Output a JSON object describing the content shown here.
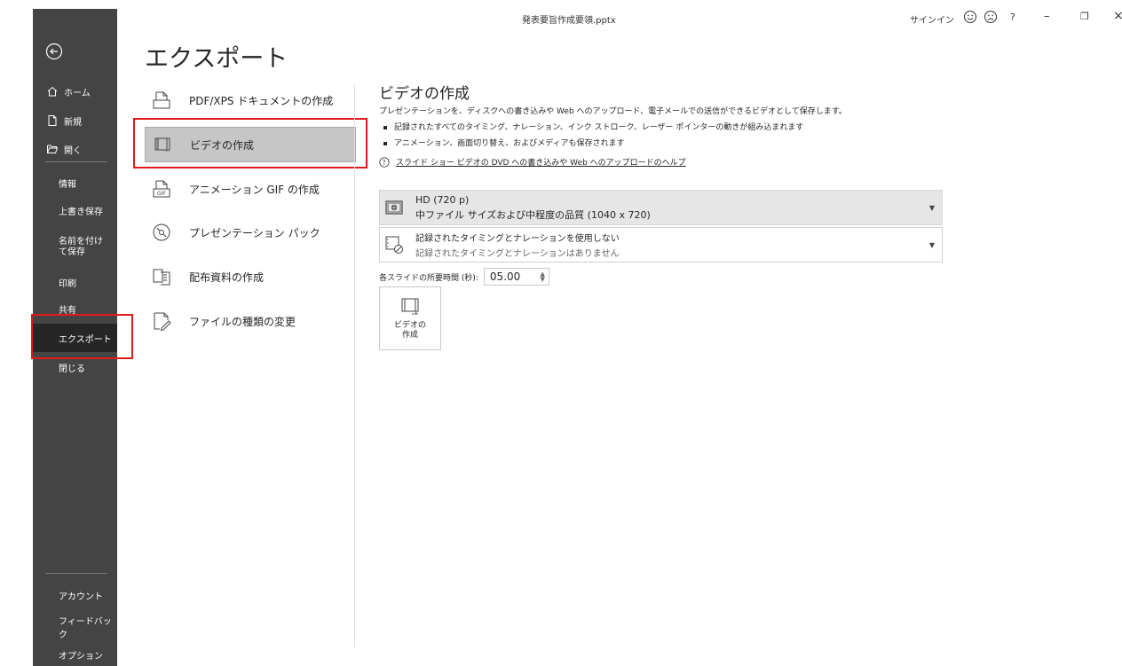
{
  "window": {
    "doc_title": "発表要旨作成要領.pptx",
    "signin": "サインイン",
    "help": "?",
    "minimize": "–",
    "restore": "❐",
    "close": "×"
  },
  "sidebar": {
    "home": "ホーム",
    "new": "新規",
    "open": "開く",
    "info": "情報",
    "save": "上書き保存",
    "save_as": "名前を付けて保存",
    "print": "印刷",
    "share": "共有",
    "export": "エクスポート",
    "close": "閉じる",
    "account": "アカウント",
    "feedback": "フィードバック",
    "options": "オプション"
  },
  "page_title": "エクスポート",
  "export_options": [
    {
      "label": "PDF/XPS ドキュメントの作成",
      "icon": "pdf-document-icon"
    },
    {
      "label": "ビデオの作成",
      "icon": "video-icon",
      "selected": true
    },
    {
      "label": "アニメーション GIF の作成",
      "icon": "gif-icon"
    },
    {
      "label": "プレゼンテーション パック",
      "icon": "package-cd-icon"
    },
    {
      "label": "配布資料の作成",
      "icon": "handouts-icon"
    },
    {
      "label": "ファイルの種類の変更",
      "icon": "change-file-type-icon"
    }
  ],
  "detail": {
    "title": "ビデオの作成",
    "description": "プレゼンテーションを、ディスクへの書き込みや Web へのアップロード、電子メールでの送信ができるビデオとして保存します。",
    "bullets": [
      "記録されたすべてのタイミング、ナレーション、インク ストローク、レーザー ポインターの動きが組み込まれます",
      "アニメーション、画面切り替え、およびメディアも保存されます"
    ],
    "help_link": "スライド ショー ビデオの DVD への書き込みや Web へのアップロードのヘルプ",
    "quality": {
      "title": "HD (720 p)",
      "subtitle": "中ファイル サイズおよび中程度の品質 (1040 x 720)"
    },
    "timing": {
      "title": "記録されたタイミングとナレーションを使用しない",
      "subtitle": "記録されたタイミングとナレーションはありません"
    },
    "duration_label": "各スライドの所要時間 (秒):",
    "duration_value": "05.00",
    "create_button": "ビデオの作成"
  },
  "colors": {
    "sidebar_bg": "#444444",
    "sidebar_active": "#262626",
    "highlight_red": "#e0191b",
    "selected_item_bg": "#c6c6c6"
  }
}
